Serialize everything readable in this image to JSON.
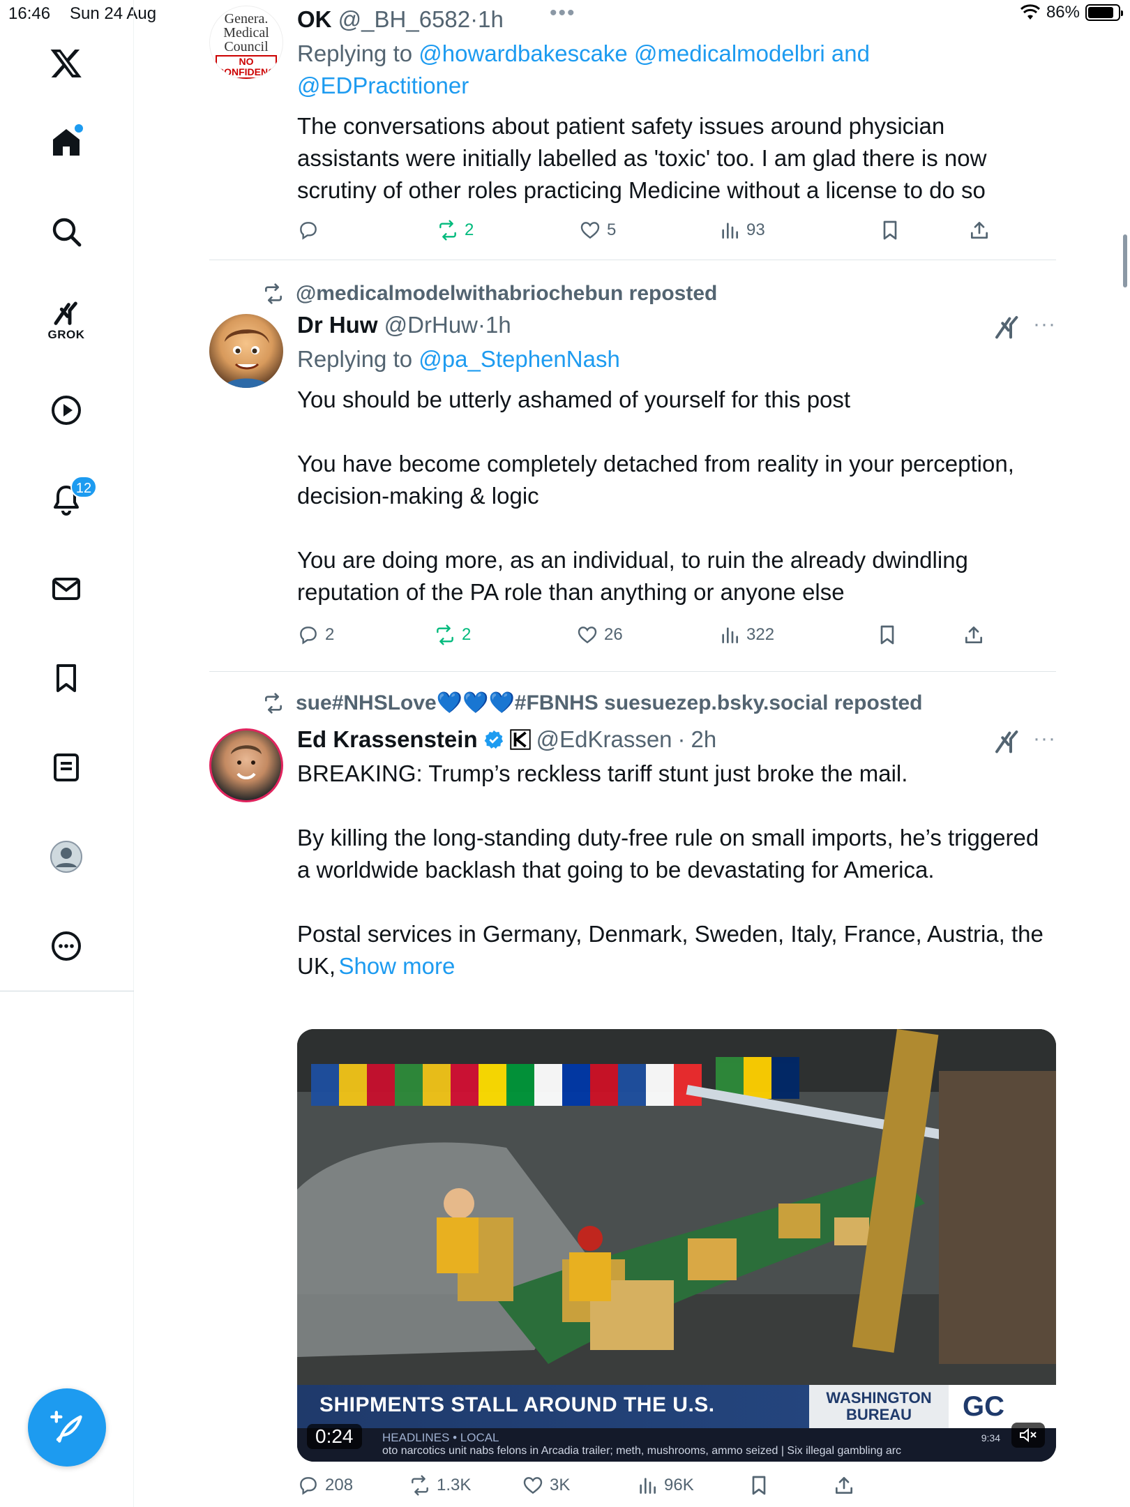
{
  "status_bar": {
    "time": "16:46",
    "date": "Sun 24 Aug",
    "dots": "•••",
    "battery": "86%",
    "battery_level": 0.86
  },
  "sidebar": {
    "grok_label": "GROK",
    "notifications_badge": "12",
    "items": [
      "x-logo",
      "home",
      "search",
      "grok",
      "videos",
      "notifications",
      "messages",
      "bookmarks",
      "lists",
      "profile",
      "more"
    ]
  },
  "tweets": [
    {
      "avatar_text_lines": [
        "Genera.",
        "Medical",
        "Council",
        "NO",
        "CONFIDENCE"
      ],
      "name": "OK",
      "handle": "@_BH_6582",
      "separator": "·",
      "time": "1h",
      "replying_prefix": "Replying to",
      "replying_to": "@howardbakescake @medicalmodelbri and @EDPractitioner",
      "text": "The conversations about patient safety issues around physician assistants were initially labelled as 'toxic' too. I am glad there is now scrutiny of other roles practicing Medicine without a license to do so",
      "replies": "",
      "reposts": "2",
      "likes": "5",
      "views": "93"
    },
    {
      "reposted_by": "@medicalmodelwithabriochebun reposted",
      "name": "Dr Huw",
      "handle": "@DrHuw",
      "separator": "·",
      "time": "1h",
      "replying_prefix": "Replying to",
      "replying_to": "@pa_StephenNash",
      "text": "You should be utterly ashamed of yourself for this post\n\nYou have become completely detached from reality in your perception, decision-making & logic\n\nYou are doing more, as an individual, to ruin the already dwindling reputation of the PA role than anything or anyone else",
      "replies": "2",
      "reposts": "2",
      "likes": "26",
      "views": "322",
      "more": "···"
    },
    {
      "reposted_by": "sue#NHSLove💙💙💙#FBNHS suesuezep.bsky.social reposted",
      "name": "Ed Krassenstein",
      "handle": "@EdKrassen",
      "separator": "·",
      "time": "2h",
      "text": "BREAKING: Trump’s reckless tariff stunt just broke the mail.\n\nBy killing the long-standing duty-free rule on small imports, he’s triggered a worldwide backlash that going to be devastating for America.\n\nPostal services in Germany, Denmark, Sweden, Italy, France, Austria, the UK,",
      "show_more": "Show more",
      "video": {
        "headline": "SHIPMENTS STALL AROUND THE U.S.",
        "bureau": "WASHINGTON BUREAU",
        "logo": "GC",
        "ticker_label": "HEADLINES • LOCAL",
        "ticker_text": "oto narcotics unit nabs felons in Arcadia trailer; meth, mushrooms, ammo seized  |  Six illegal gambling arc",
        "clock": "9:34",
        "timecode": "0:24"
      },
      "replies": "208",
      "reposts": "1.3K",
      "likes": "3K",
      "views": "96K",
      "more": "···"
    }
  ],
  "colors": {
    "accent": "#1d9bf0",
    "repost_green": "#00ba7c",
    "muted": "#536471",
    "text": "#0f1419"
  }
}
